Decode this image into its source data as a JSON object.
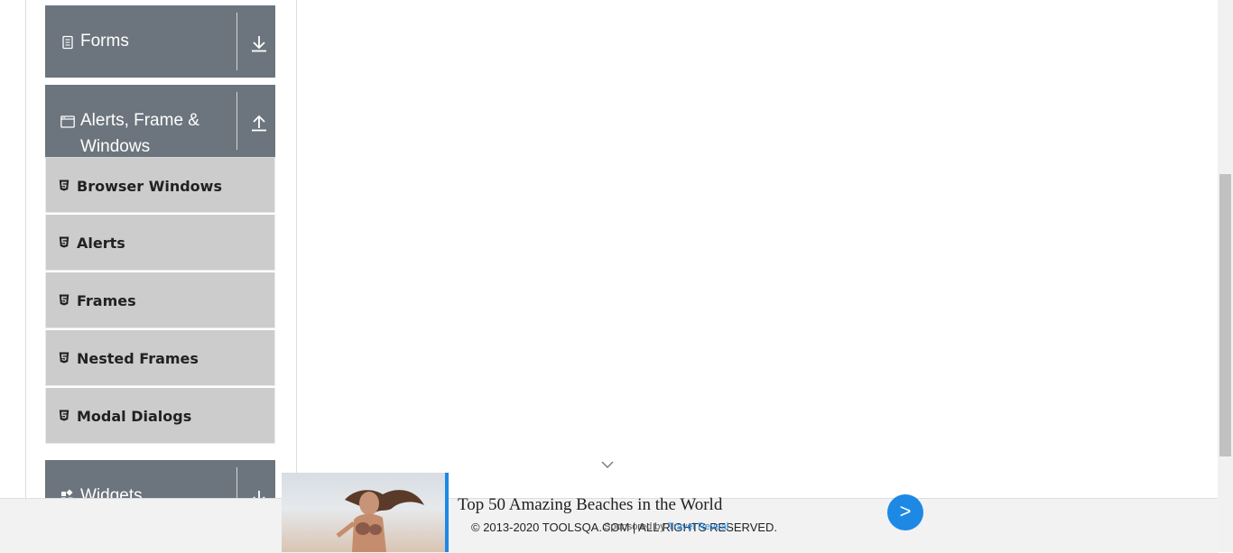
{
  "sidebar": {
    "groups": [
      {
        "label": "Forms",
        "icon": "file-text-icon",
        "toggle_icon": "download-arrow-icon"
      },
      {
        "label_line1": "Alerts, Frame &",
        "label_line2": "Windows",
        "icon": "window-icon",
        "toggle_icon": "upload-arrow-icon"
      },
      {
        "label": "Widgets",
        "icon": "widgets-icon",
        "toggle_icon": "download-arrow-icon"
      }
    ],
    "items": [
      {
        "label": "Browser Windows",
        "icon": "html5-icon"
      },
      {
        "label": "Alerts",
        "icon": "html5-icon"
      },
      {
        "label": "Frames",
        "icon": "html5-icon"
      },
      {
        "label": "Nested Frames",
        "icon": "html5-icon"
      },
      {
        "label": "Modal Dialogs",
        "icon": "html5-icon"
      }
    ]
  },
  "footer": {
    "copyright": "© 2013-2020 TOOLSQA.COM | ALL RIGHTS RESERVED."
  },
  "ad": {
    "title": "Top 50 Amazing Beaches in the World",
    "sponsored_prefix": "Sponsored by",
    "sponsor": "Travel Reveal",
    "cta": ">"
  },
  "colors": {
    "group_header_bg": "#6c757d",
    "menu_item_bg": "#cccccc",
    "accent": "#1e88e5"
  }
}
